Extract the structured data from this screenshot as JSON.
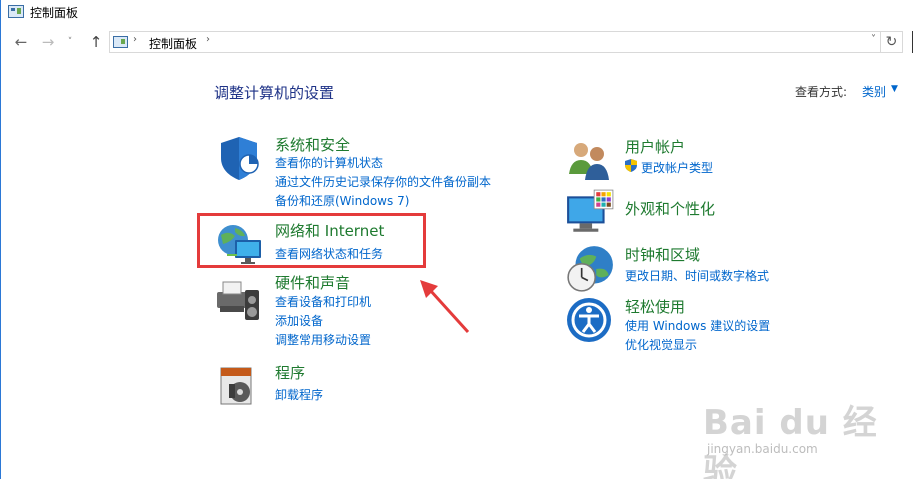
{
  "window": {
    "title": "控制面板"
  },
  "nav": {
    "back_glyph": "←",
    "forward_glyph": "→",
    "recent_glyph": "˅",
    "up_glyph": "↑",
    "breadcrumb_sep": "›",
    "breadcrumb": "控制面板",
    "dropdown_glyph": "˅",
    "refresh_glyph": "↻"
  },
  "main": {
    "title": "调整计算机的设置",
    "view_by_label": "查看方式:",
    "view_by_value": "类别",
    "view_by_caret": "▼"
  },
  "categories": [
    {
      "title": "系统和安全",
      "icon": "shield-icon",
      "links": [
        "查看你的计算机状态",
        "通过文件历史记录保存你的文件备份副本",
        "备份和还原(Windows 7)"
      ]
    },
    {
      "title": "网络和 Internet",
      "icon": "network-icon",
      "links": [
        "查看网络状态和任务"
      ]
    },
    {
      "title": "硬件和声音",
      "icon": "printer-icon",
      "links": [
        "查看设备和打印机",
        "添加设备",
        "调整常用移动设置"
      ]
    },
    {
      "title": "程序",
      "icon": "programs-icon",
      "links": [
        "卸载程序"
      ]
    },
    {
      "title": "用户帐户",
      "icon": "users-icon",
      "links": [
        "更改帐户类型"
      ]
    },
    {
      "title": "外观和个性化",
      "icon": "monitor-icon",
      "links": []
    },
    {
      "title": "时钟和区域",
      "icon": "clock-globe-icon",
      "links": [
        "更改日期、时间或数字格式"
      ]
    },
    {
      "title": "轻松使用",
      "icon": "ease-of-access-icon",
      "links": [
        "使用 Windows 建议的设置",
        "优化视觉显示"
      ]
    }
  ],
  "watermark": {
    "main": "Bai du 经验",
    "sub": "jingyan.baidu.com"
  },
  "colors": {
    "category_title": "#1e7a2f",
    "link": "#0066cc",
    "page_title": "#1e3287",
    "annotation": "#e43b3b"
  }
}
